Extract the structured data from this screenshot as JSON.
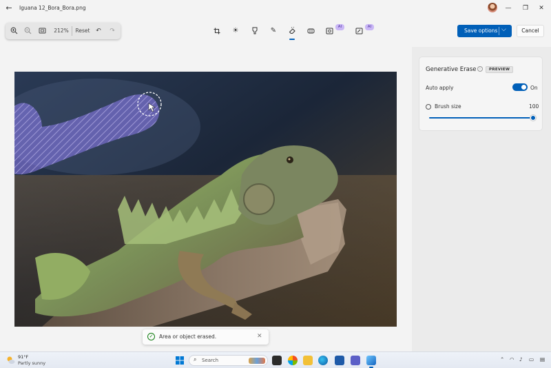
{
  "window": {
    "title": "Iguana 12_Bora_Bora.png",
    "back_icon": "arrow-left-icon",
    "minimize_icon": "minimize-icon",
    "maximize_icon": "restore-icon",
    "close_icon": "close-icon"
  },
  "zoom_controls": {
    "zoom_in_icon": "zoom-in-icon",
    "zoom_out_icon": "zoom-out-icon",
    "fit_icon": "fit-to-window-icon",
    "zoom_level": "212%",
    "reset_label": "Reset",
    "undo_icon": "undo-icon",
    "redo_icon": "redo-icon"
  },
  "edit_tools": [
    {
      "name": "crop",
      "icon": "crop-icon"
    },
    {
      "name": "adjust",
      "icon": "brightness-icon"
    },
    {
      "name": "filter",
      "icon": "filter-icon"
    },
    {
      "name": "markup",
      "icon": "pen-icon"
    },
    {
      "name": "erase",
      "icon": "eraser-icon",
      "active": true
    },
    {
      "name": "retouch",
      "icon": "bandage-icon"
    },
    {
      "name": "background",
      "icon": "background-icon",
      "badge": "AI"
    },
    {
      "name": "generative",
      "icon": "ai-edit-icon",
      "badge": "AI"
    }
  ],
  "actions": {
    "save_label": "Save options",
    "cancel_label": "Cancel"
  },
  "panel": {
    "title": "Generative Erase",
    "badge": "PREVIEW",
    "auto_apply_label": "Auto apply",
    "auto_apply_state": "On",
    "auto_apply_on": true,
    "brush_size_label": "Brush size",
    "brush_size_value": "100",
    "brush_size_fraction": 1.0
  },
  "toast": {
    "message": "Area or object erased."
  },
  "taskbar": {
    "weather_temp": "91°F",
    "weather_desc": "Partly sunny",
    "search_placeholder": "Search"
  },
  "colors": {
    "accent": "#005fb8",
    "ai_badge": "#c9b6f5",
    "erase_mask": "#8e7df2",
    "success": "#107c10"
  }
}
